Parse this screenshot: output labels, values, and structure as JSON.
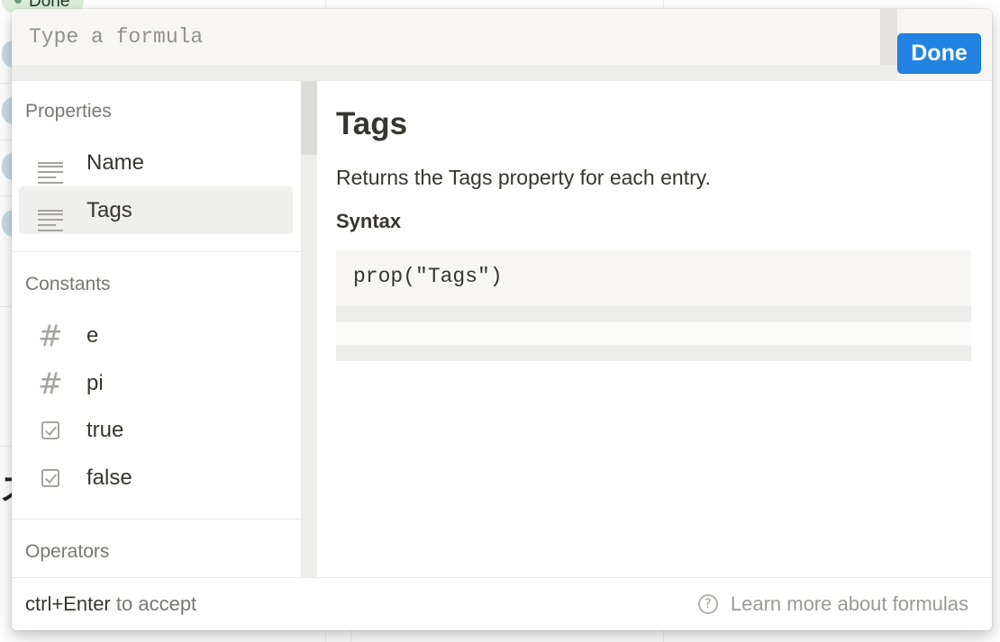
{
  "background": {
    "tag_label": "Done"
  },
  "formula": {
    "placeholder": "Type a formula",
    "value": "",
    "done_label": "Done"
  },
  "sidebar": {
    "sections": [
      {
        "title": "Properties",
        "items": [
          {
            "label": "Name",
            "icon": "text-lines-icon",
            "selected": false
          },
          {
            "label": "Tags",
            "icon": "text-lines-icon",
            "selected": true
          }
        ]
      },
      {
        "title": "Constants",
        "items": [
          {
            "label": "e",
            "icon": "hash-icon"
          },
          {
            "label": "pi",
            "icon": "hash-icon"
          },
          {
            "label": "true",
            "icon": "checkbox-icon"
          },
          {
            "label": "false",
            "icon": "checkbox-icon"
          }
        ]
      },
      {
        "title": "Operators",
        "items": []
      }
    ]
  },
  "doc": {
    "title": "Tags",
    "description": "Returns the Tags property for each entry.",
    "syntax_label": "Syntax",
    "code": "prop(\"Tags\")"
  },
  "footer": {
    "shortcut": "ctrl+Enter",
    "shortcut_suffix": "to accept",
    "help_icon": "?",
    "link_label": "Learn more about formulas"
  },
  "colors": {
    "accent": "#2383e2",
    "text": "#37352f",
    "muted": "#787774",
    "selected_bg": "#efefee"
  }
}
